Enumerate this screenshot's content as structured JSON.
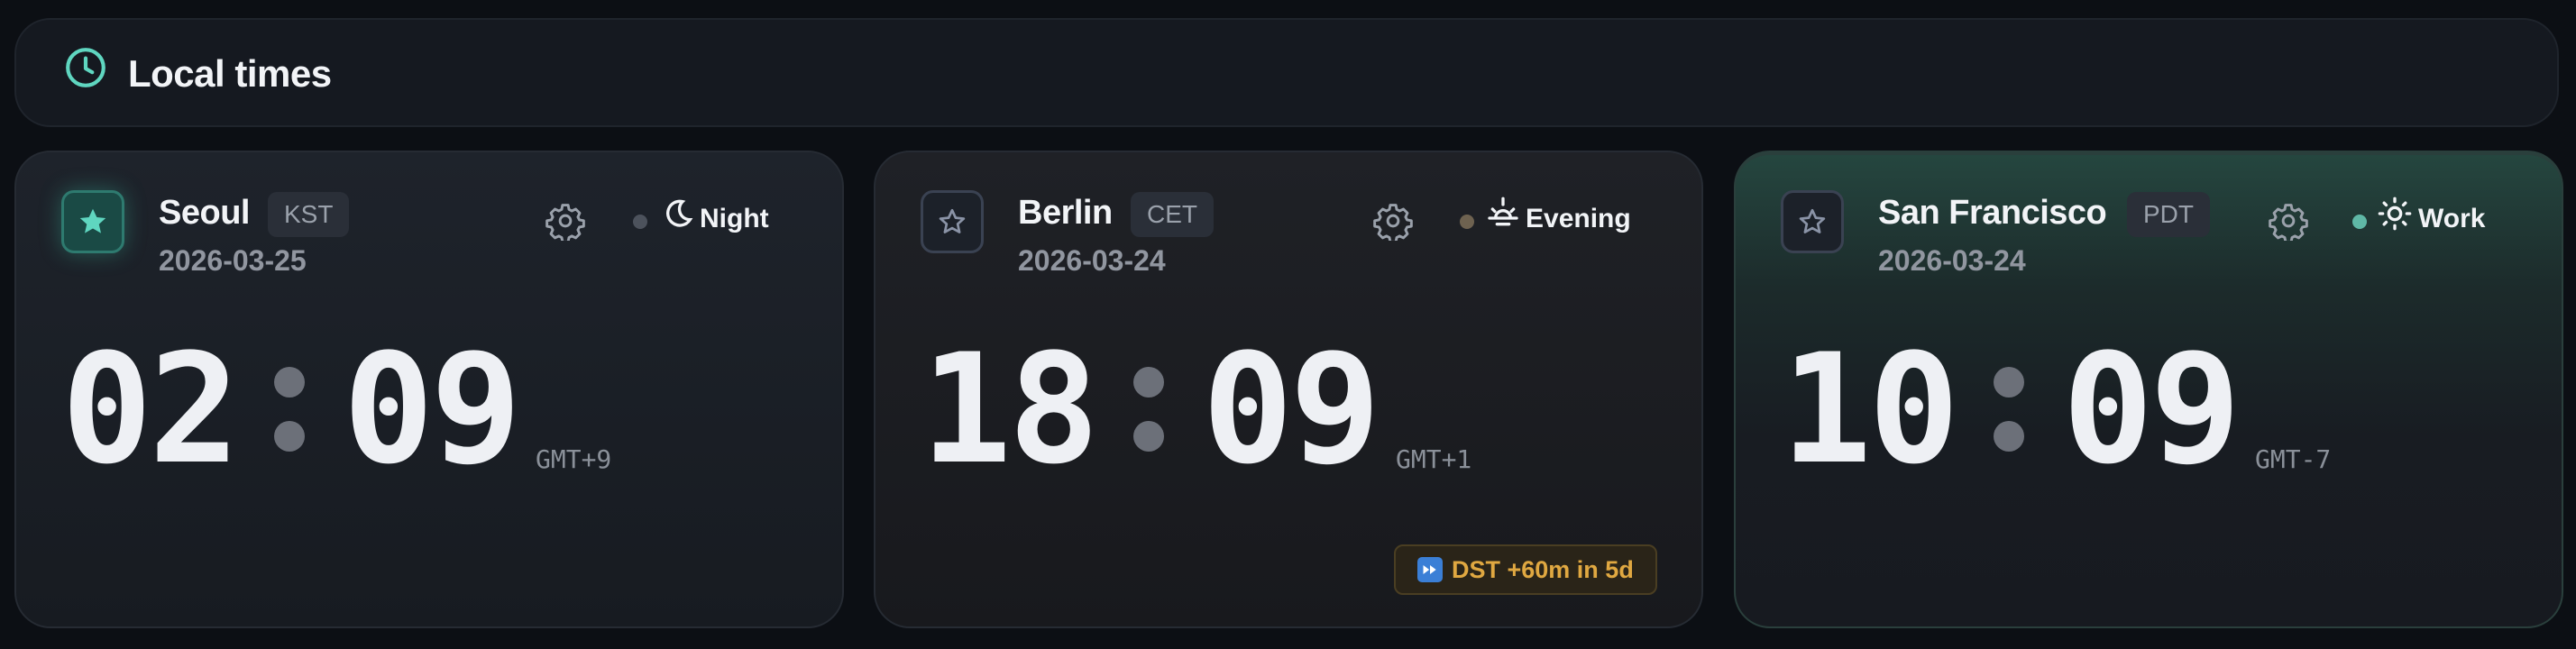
{
  "header": {
    "title": "Local times"
  },
  "colors": {
    "accent": "#5fd6c0",
    "dst": "#e0a841",
    "night_dot": "#4c525c",
    "evening_dot": "#6e6250",
    "work_dot": "#5fb8a6"
  },
  "clocks": [
    {
      "city": "Seoul",
      "tz": "KST",
      "date": "2026-03-25",
      "hours": "02",
      "minutes": "09",
      "offset": "GMT+9",
      "status": "Night",
      "status_icon": "moon-icon",
      "favorite": true
    },
    {
      "city": "Berlin",
      "tz": "CET",
      "date": "2026-03-24",
      "hours": "18",
      "minutes": "09",
      "offset": "GMT+1",
      "status": "Evening",
      "status_icon": "sunset-icon",
      "favorite": false,
      "dst_notice": "DST +60m in 5d"
    },
    {
      "city": "San Francisco",
      "tz": "PDT",
      "date": "2026-03-24",
      "hours": "10",
      "minutes": "09",
      "offset": "GMT-7",
      "status": "Work",
      "status_icon": "sun-icon",
      "favorite": false
    }
  ]
}
